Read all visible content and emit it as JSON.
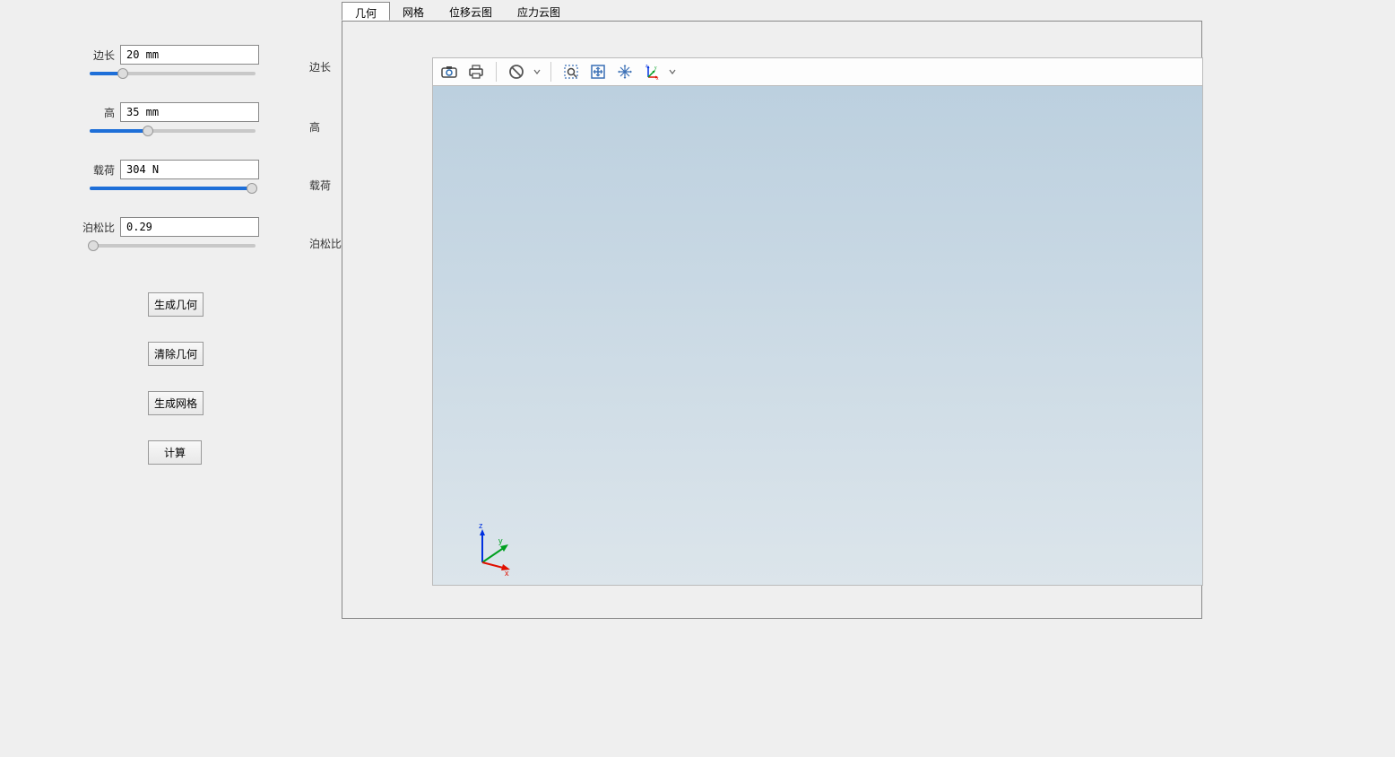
{
  "params": {
    "bianchang": {
      "label": "边长",
      "value": "20 mm",
      "slider_pct": 20
    },
    "gao": {
      "label": "高",
      "value": "35 mm",
      "slider_pct": 35
    },
    "zaihe": {
      "label": "载荷",
      "value": "304 N",
      "slider_pct": 98
    },
    "bosongbi": {
      "label": "泊松比",
      "value": "0.29",
      "slider_pct": 2
    }
  },
  "col2_labels": {
    "bianchang": "边长",
    "gao": "高",
    "zaihe": "载荷",
    "bosongbi": "泊松比"
  },
  "buttons": {
    "gen_geom": "生成几何",
    "clear_geom": "清除几何",
    "gen_mesh": "生成网格",
    "compute": "计算"
  },
  "tabs": {
    "geom": "几何",
    "mesh": "网格",
    "disp": "位移云图",
    "stress": "应力云图"
  },
  "toolbar": {
    "camera": "camera-icon",
    "print": "print-icon",
    "forbid": "forbid-icon",
    "zoombox": "zoom-box-icon",
    "fit": "fit-icon",
    "pan": "pan-icon",
    "coord": "coord-sys-icon"
  },
  "axes": {
    "x": "x",
    "y": "y",
    "z": "z"
  }
}
